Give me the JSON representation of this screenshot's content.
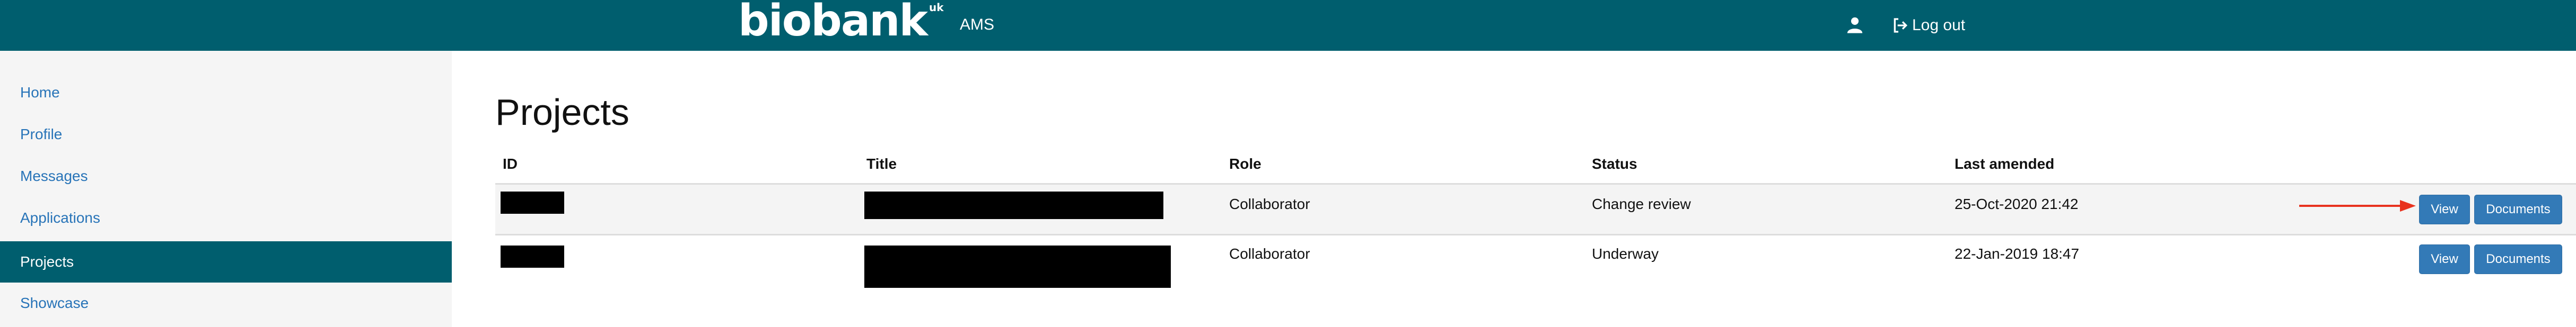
{
  "header": {
    "logo_text": "biobank",
    "logo_superscript": "uk",
    "app_name": "AMS",
    "user_icon": "user-icon",
    "logout_icon": "logout-icon",
    "logout_label": "Log out",
    "background_color": "#005e6e"
  },
  "sidebar": {
    "items": [
      {
        "label": "Home",
        "active": false
      },
      {
        "label": "Profile",
        "active": false
      },
      {
        "label": "Messages",
        "active": false
      },
      {
        "label": "Applications",
        "active": false
      },
      {
        "label": "Projects",
        "active": true
      },
      {
        "label": "Showcase",
        "active": false
      }
    ],
    "link_color": "#2874b8",
    "active_color": "#005e6e"
  },
  "main": {
    "title": "Projects",
    "table": {
      "headers": [
        "ID",
        "Title",
        "Role",
        "Status",
        "Last amended"
      ],
      "rows": [
        {
          "id": "",
          "title": "",
          "role": "Collaborator",
          "status": "Change review",
          "last_amended": "25-Oct-2020 21:42",
          "view_label": "View",
          "documents_label": "Documents"
        },
        {
          "id": "",
          "title": "",
          "role": "Collaborator",
          "status": "Underway",
          "last_amended": "22-Jan-2019 18:47",
          "view_label": "View",
          "documents_label": "Documents"
        }
      ]
    },
    "button_color": "#337ab7",
    "annotation_arrow_color": "#e8321e"
  }
}
